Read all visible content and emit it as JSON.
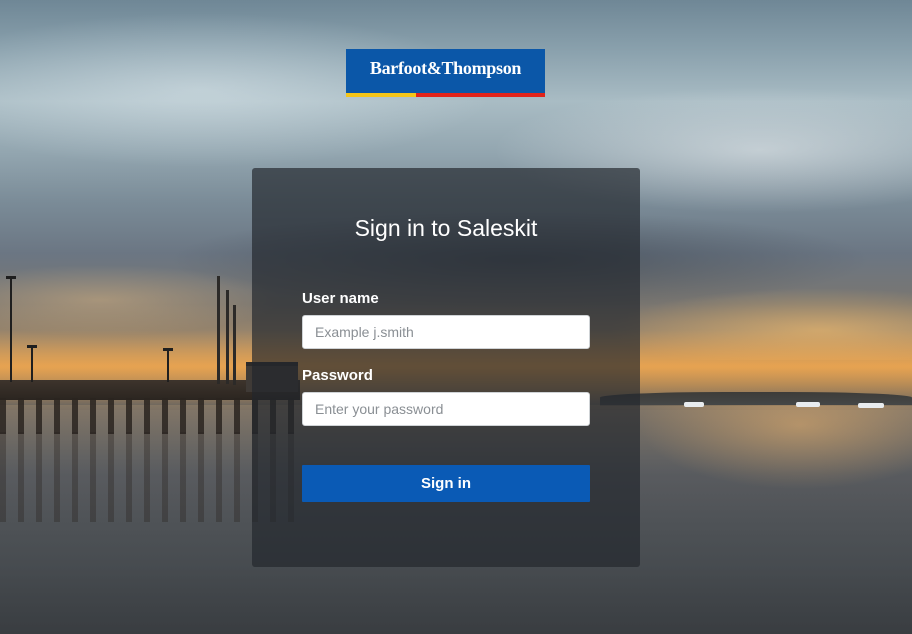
{
  "brand": {
    "logo_text": "Barfoot&Thompson",
    "colors": {
      "logo_blue": "#0b57a8",
      "stripe_yellow": "#f5c518",
      "stripe_red": "#e2231a"
    }
  },
  "login": {
    "title": "Sign in to Saleskit",
    "username": {
      "label": "User name",
      "placeholder": "Example j.smith",
      "value": ""
    },
    "password": {
      "label": "Password",
      "placeholder": "Enter your password",
      "value": ""
    },
    "submit_label": "Sign in",
    "button_color": "#0a5ab5"
  }
}
